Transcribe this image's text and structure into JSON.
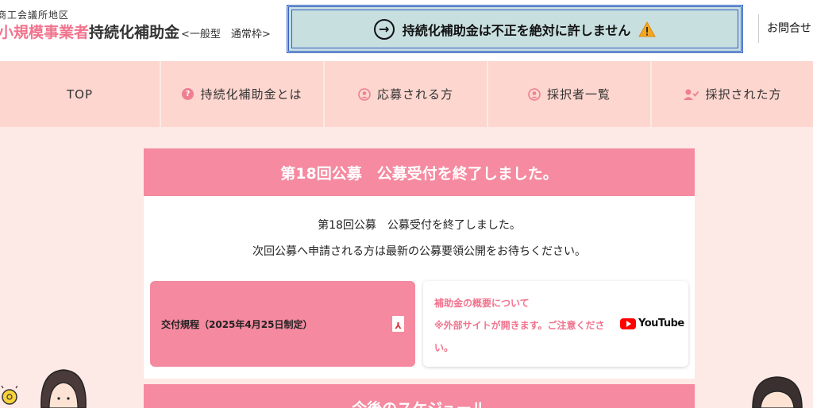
{
  "header": {
    "brand_sub": "商工会議所地区",
    "brand_accent": "小規模事業者",
    "brand_title": "持続化補助金",
    "brand_type": "<一般型　通常枠>",
    "alert_text": "持続化補助金は不正を絶対に許しません",
    "contact_label": "お問合せ"
  },
  "nav": {
    "items": [
      {
        "label": "TOP",
        "icon": ""
      },
      {
        "label": "持続化補助金とは",
        "icon": "question-circle-icon"
      },
      {
        "label": "応募される方",
        "icon": "user-circle-icon"
      },
      {
        "label": "採択者一覧",
        "icon": "user-circle-icon"
      },
      {
        "label": "採択された方",
        "icon": "user-check-icon"
      }
    ]
  },
  "notice": {
    "heading": "第18回公募　公募受付を終了しました。",
    "line1": "第18回公募　公募受付を終了しました。",
    "line2": "次回公募へ申請される方は最新の公募要領公開をお待ちください。"
  },
  "cards": {
    "pdf_label": "交付規程（2025年4月25日制定）",
    "pdf_icon": "pdf-icon",
    "yt_title": "補助金の概要について",
    "yt_note": "※外部サイトが開きます。ご注意ください。",
    "yt_logo_text": "YouTube"
  },
  "schedule": {
    "heading": "今後のスケジュール"
  },
  "colors": {
    "accent": "#f0748e",
    "nav_bg": "#fcd6cf",
    "page_bg": "#fde9e5",
    "alert_bg": "#c8dfe0",
    "alert_border": "#2f5cc4"
  }
}
